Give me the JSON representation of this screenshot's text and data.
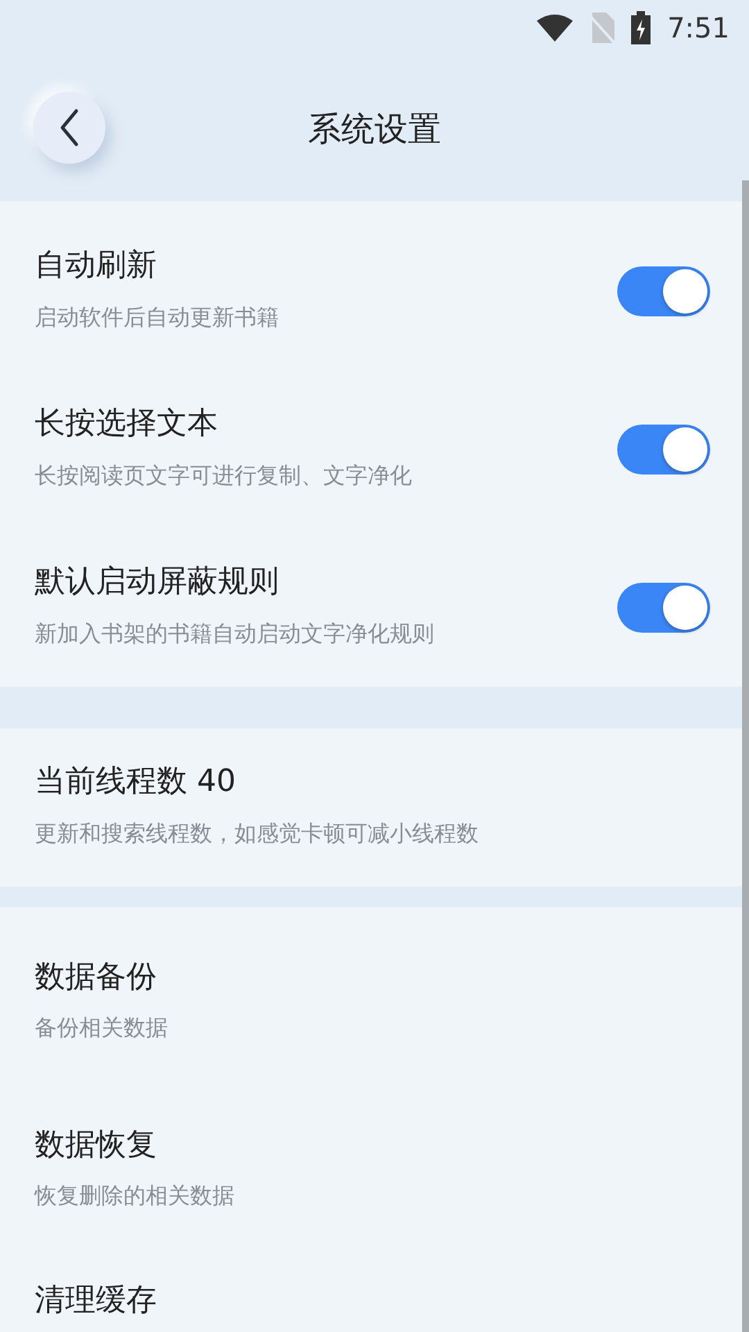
{
  "status_bar": {
    "time": "7:51"
  },
  "header": {
    "title": "系统设置"
  },
  "groups": [
    {
      "items": [
        {
          "title": "自动刷新",
          "subtitle": "启动软件后自动更新书籍",
          "kind": "switch",
          "on": true
        },
        {
          "title": "长按选择文本",
          "subtitle": "长按阅读页文字可进行复制、文字净化",
          "kind": "switch",
          "on": true
        },
        {
          "title": "默认启动屏蔽规则",
          "subtitle": "新加入书架的书籍自动启动文字净化规则",
          "kind": "switch",
          "on": true
        }
      ]
    },
    {
      "items": [
        {
          "title": "当前线程数 40",
          "subtitle": "更新和搜索线程数，如感觉卡顿可减小线程数",
          "kind": "plain"
        }
      ]
    },
    {
      "items": [
        {
          "title": "数据备份",
          "subtitle": "备份相关数据",
          "kind": "plain"
        },
        {
          "title": "数据恢复",
          "subtitle": "恢复删除的相关数据",
          "kind": "plain"
        },
        {
          "title": "清理缓存",
          "kind": "plain"
        }
      ]
    }
  ]
}
